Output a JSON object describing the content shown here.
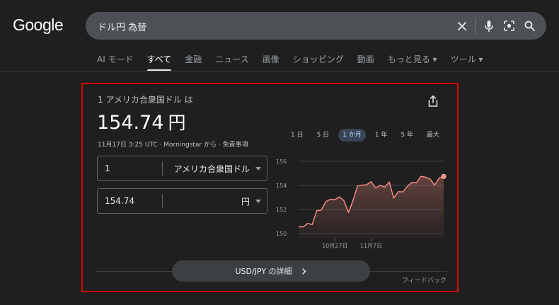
{
  "header": {
    "logo": "Google",
    "search_value": "ドル円 為替"
  },
  "tabs": [
    {
      "label": "AI モード"
    },
    {
      "label": "すべて",
      "active": true
    },
    {
      "label": "金融"
    },
    {
      "label": "ニュース"
    },
    {
      "label": "画像"
    },
    {
      "label": "ショッピング"
    },
    {
      "label": "動画"
    },
    {
      "label": "もっと見る ▾"
    },
    {
      "label": "ツール ▾"
    }
  ],
  "converter": {
    "lead_text": "1 アメリカ合衆国ドル は",
    "rate_value": "154.74",
    "rate_unit": "円",
    "meta": "11月17日 3:25 UTC · Morningstar から · 免責事項",
    "from_amount": "1",
    "from_currency": "アメリカ合衆国ドル",
    "to_amount": "154.74",
    "to_currency": "円",
    "details_label": "USD/JPY の詳細",
    "feedback": "フィードバック"
  },
  "ranges": [
    "1 日",
    "5 日",
    "1 か月",
    "1 年",
    "5 年",
    "最大"
  ],
  "selected_range": "1 か月",
  "chart_data": {
    "type": "area",
    "title": "",
    "xlabel": "",
    "ylabel": "",
    "ylim": [
      149.6,
      156.4
    ],
    "yticks": [
      150,
      152,
      154,
      156
    ],
    "xticks": [
      {
        "label": "10月27日",
        "index": 8
      },
      {
        "label": "11月7日",
        "index": 16
      }
    ],
    "values": [
      150.58,
      150.55,
      150.85,
      150.75,
      151.9,
      151.95,
      152.65,
      152.85,
      152.82,
      153.05,
      152.72,
      151.75,
      152.75,
      153.95,
      154.02,
      154.05,
      154.3,
      153.78,
      154.0,
      153.85,
      154.28,
      152.95,
      153.48,
      153.45,
      153.92,
      154.25,
      154.22,
      154.75,
      154.68,
      154.52,
      154.02,
      154.6,
      154.74
    ],
    "line_color": "#f28b82",
    "fill_color": "#f28b82"
  }
}
